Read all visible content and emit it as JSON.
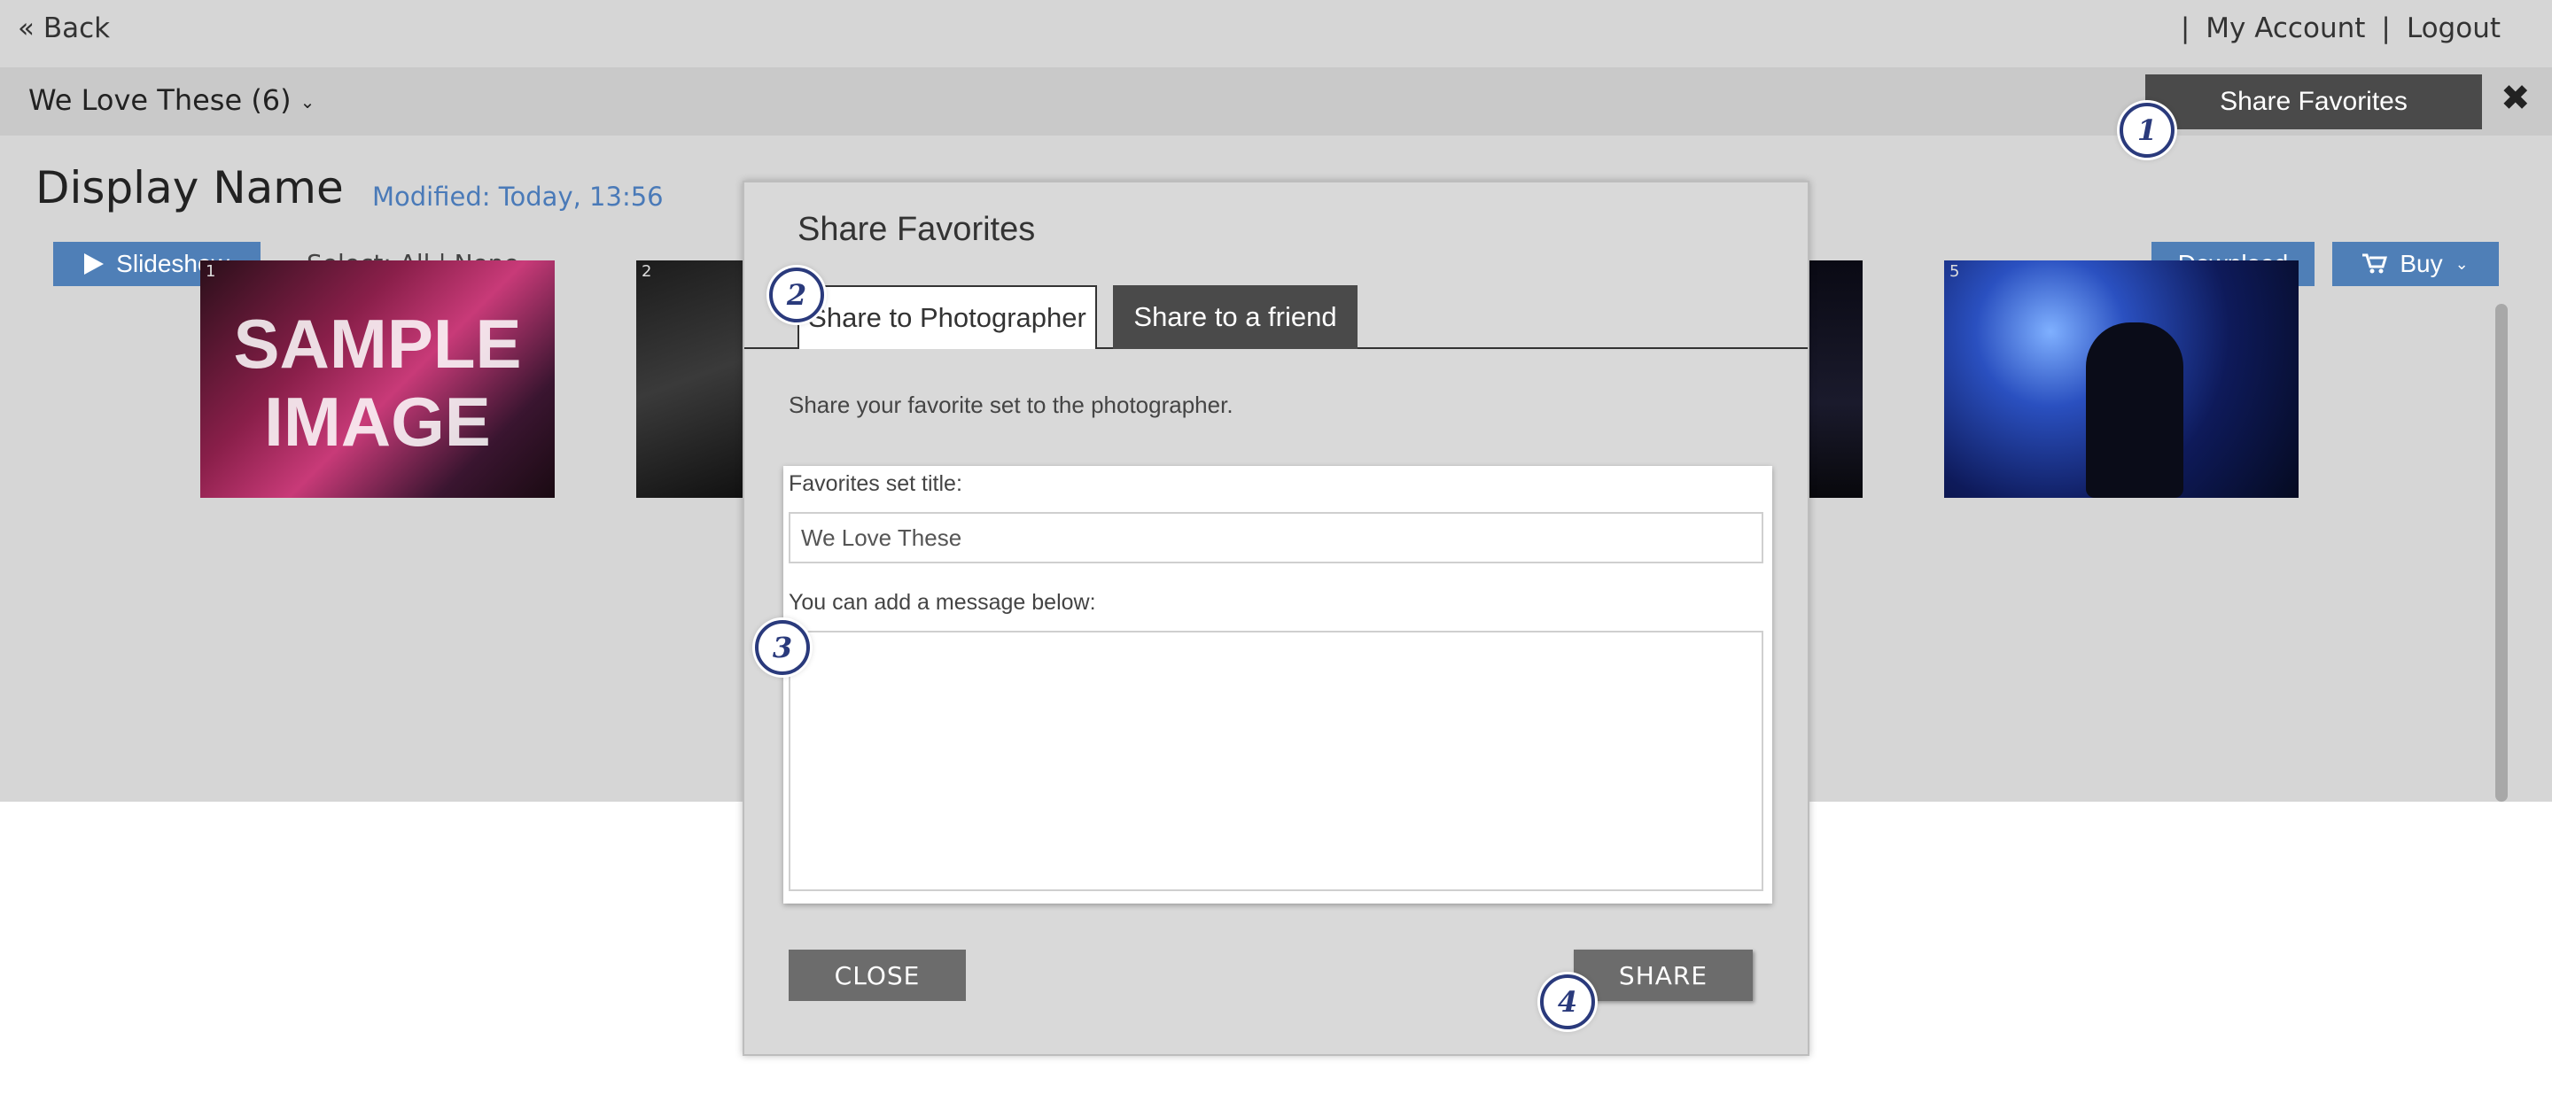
{
  "topbar": {
    "back_label": "« Back",
    "separator": "|",
    "my_account_label": "My Account",
    "logout_label": "Logout"
  },
  "subbar": {
    "album_label": "We Love These (6)",
    "share_favorites_label": "Share Favorites",
    "close_icon": "✖"
  },
  "main": {
    "display_name": "Display Name",
    "modified": "Modified: Today, 13:56",
    "slideshow_label": "Slideshow",
    "select_label": "Select: All | None",
    "download_label": "Download",
    "buy_label": "Buy",
    "thumbnails": [
      {
        "number": "1",
        "overlay": "SAMPLE IMAGE"
      },
      {
        "number": "2"
      },
      {
        "number": "5"
      }
    ]
  },
  "modal": {
    "title": "Share Favorites",
    "tabs": [
      {
        "label": "Share to Photographer",
        "active": true
      },
      {
        "label": "Share to a friend",
        "active": false
      }
    ],
    "description": "Share your favorite set to the photographer.",
    "title_field_label": "Favorites set title:",
    "title_field_value": "We Love These",
    "message_label": "You can add a message below:",
    "message_value": "",
    "close_label": "CLOSE",
    "share_label": "SHARE"
  },
  "badges": [
    "1",
    "2",
    "3",
    "4"
  ],
  "colors": {
    "accent_blue": "#4f7fb7",
    "dark_button": "#4a4a4a",
    "badge_blue": "#2a3a7c",
    "modified_text": "#4a7ab8"
  },
  "icons": {
    "play": "play-icon",
    "cart": "cart-icon",
    "chevron": "chevron-down-icon",
    "close": "close-icon"
  }
}
